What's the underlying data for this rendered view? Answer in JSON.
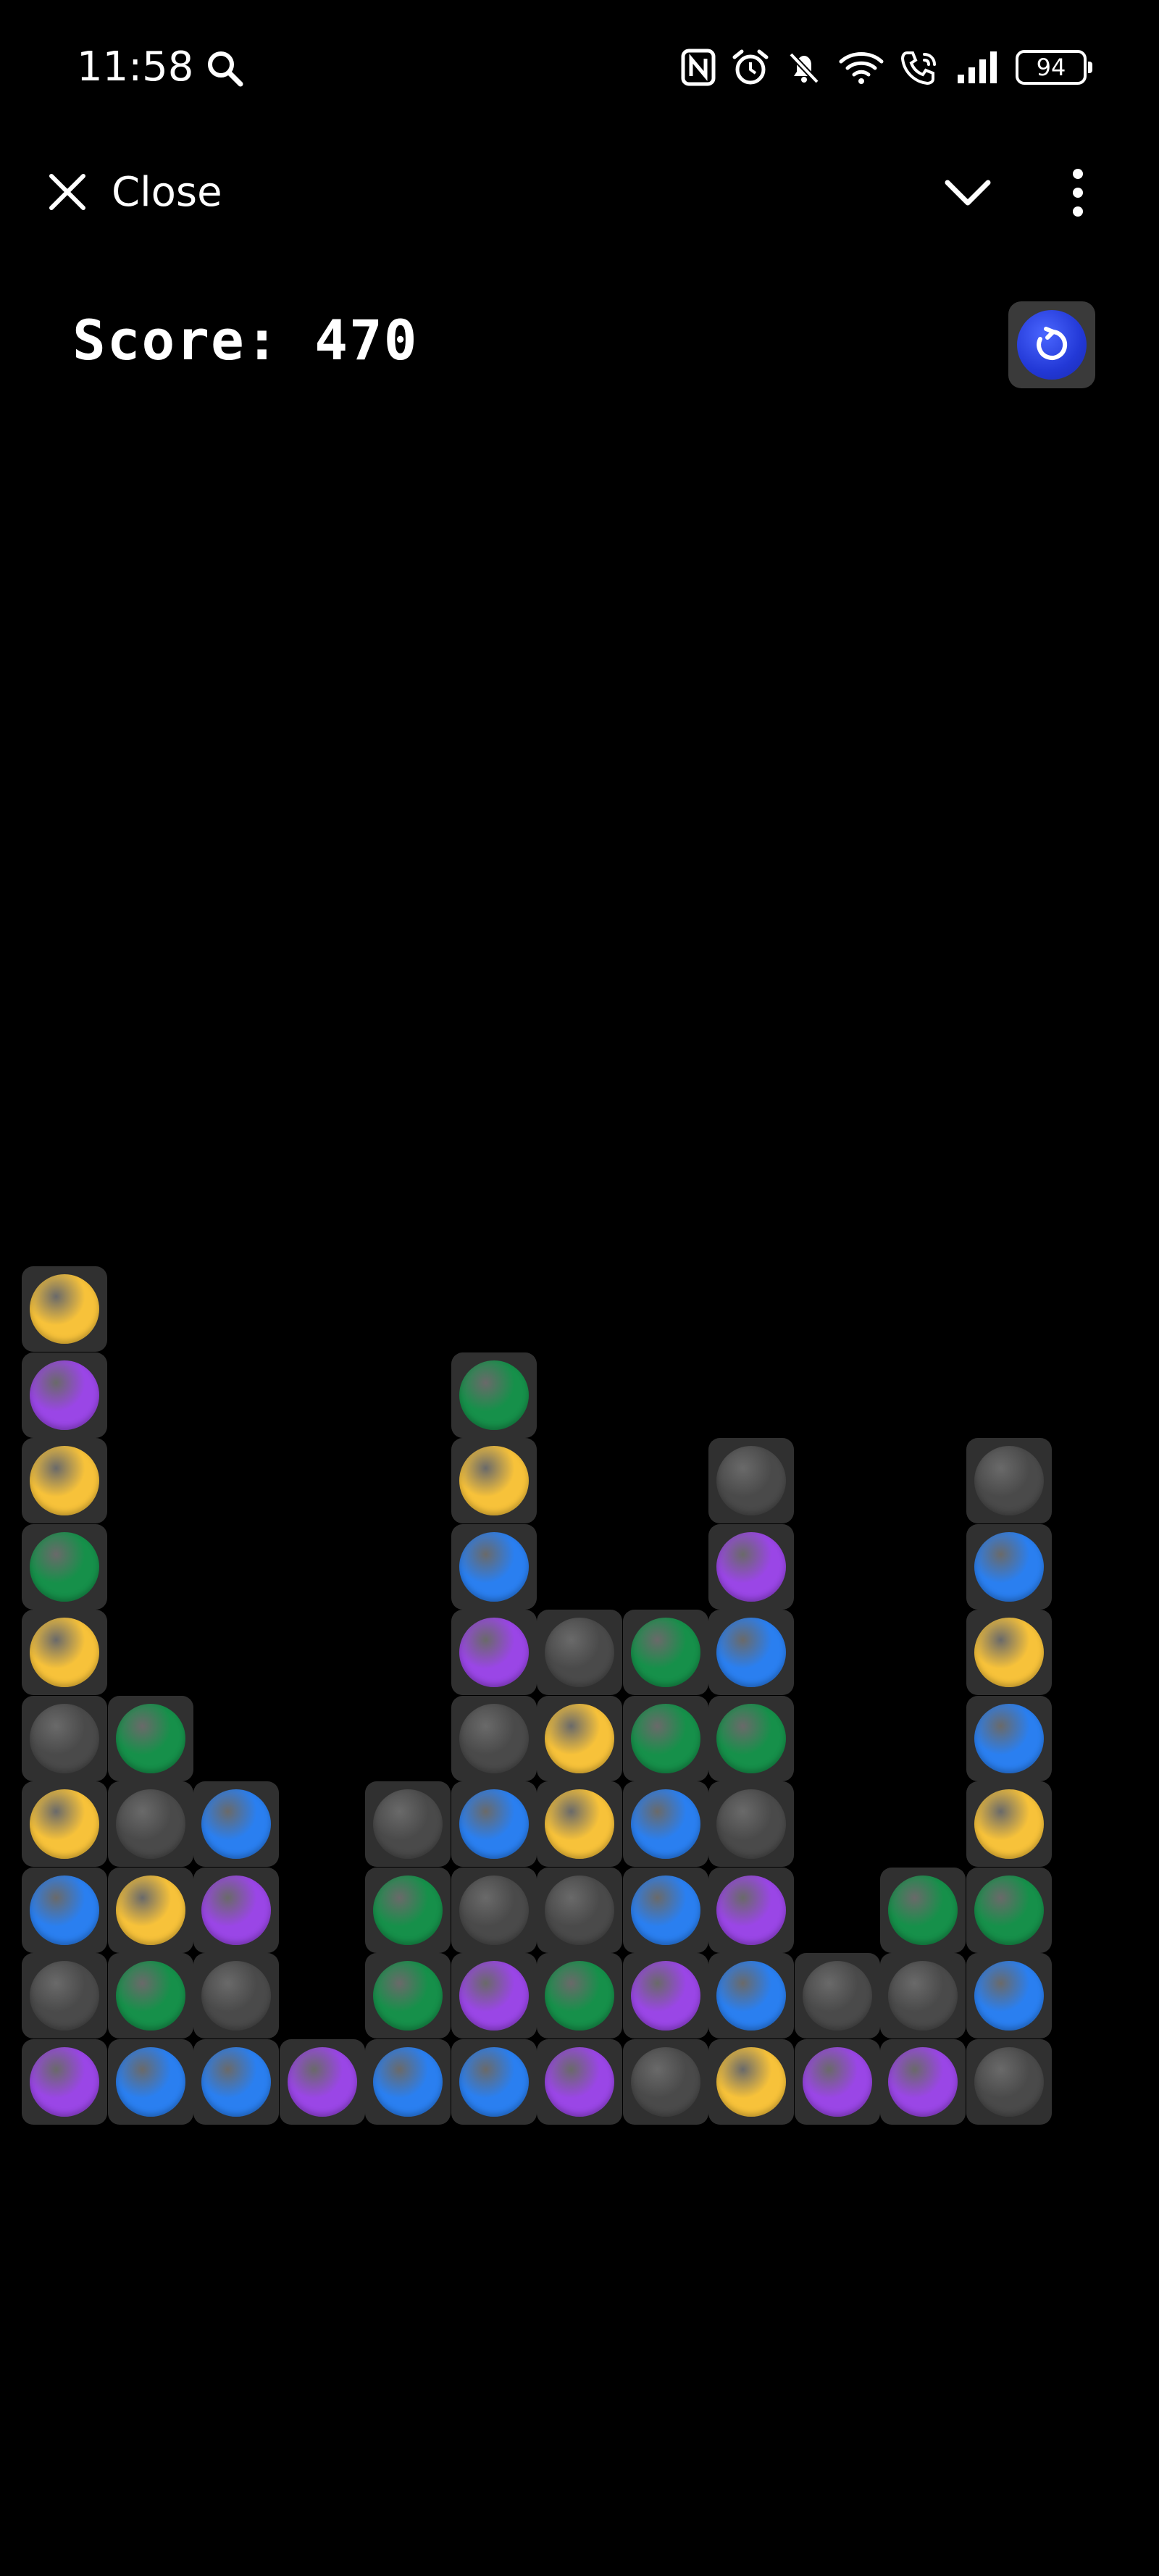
{
  "status_bar": {
    "time": "11:58",
    "battery": "94"
  },
  "top_bar": {
    "close_label": "Close"
  },
  "score": {
    "text": "Score: 470"
  },
  "colors": {
    "Y": "#f7c23a",
    "P": "#9a46e6",
    "G": "#16904a",
    "B": "#2a7ff0",
    "K": "#4a4a4a"
  },
  "board": {
    "columns": 12,
    "rows": 10,
    "grid": [
      [
        "Y",
        "",
        "",
        "",
        "",
        "",
        "",
        "",
        "",
        "",
        "",
        ""
      ],
      [
        "P",
        "",
        "",
        "",
        "",
        "G",
        "",
        "",
        "",
        "",
        "",
        ""
      ],
      [
        "Y",
        "",
        "",
        "",
        "",
        "Y",
        "",
        "",
        "K",
        "",
        "",
        "K"
      ],
      [
        "G",
        "",
        "",
        "",
        "",
        "B",
        "",
        "",
        "P",
        "",
        "",
        "B"
      ],
      [
        "Y",
        "",
        "",
        "",
        "",
        "P",
        "K",
        "G",
        "B",
        "",
        "",
        "Y"
      ],
      [
        "K",
        "G",
        "",
        "",
        "",
        "K",
        "Y",
        "G",
        "G",
        "",
        "",
        "B"
      ],
      [
        "Y",
        "K",
        "B",
        "",
        "K",
        "B",
        "Y",
        "B",
        "K",
        "",
        "",
        "Y"
      ],
      [
        "B",
        "Y",
        "P",
        "",
        "G",
        "K",
        "K",
        "B",
        "P",
        "",
        "G",
        "G"
      ],
      [
        "K",
        "G",
        "K",
        "",
        "G",
        "P",
        "G",
        "P",
        "B",
        "K",
        "K",
        "B"
      ],
      [
        "P",
        "B",
        "B",
        "P",
        "B",
        "B",
        "P",
        "K",
        "Y",
        "P",
        "P",
        "K"
      ]
    ]
  }
}
